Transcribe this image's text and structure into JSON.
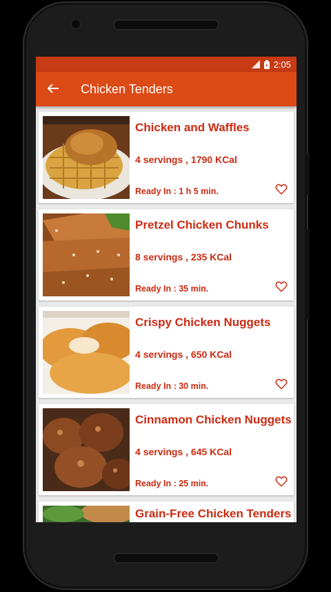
{
  "status_bar": {
    "time": "2:05"
  },
  "app_bar": {
    "title": "Chicken Tenders"
  },
  "recipes": [
    {
      "name": "Chicken and Waffles",
      "servings": "4 servings , 1790 KCal",
      "ready": "Ready In : 1 h 5 min."
    },
    {
      "name": "Pretzel Chicken Chunks",
      "servings": "8 servings , 235 KCal",
      "ready": "Ready In : 35 min."
    },
    {
      "name": "Crispy Chicken Nuggets",
      "servings": "4 servings , 650 KCal",
      "ready": "Ready In : 30 min."
    },
    {
      "name": "Cinnamon Chicken Nuggets",
      "servings": "4 servings , 645 KCal",
      "ready": "Ready In : 25 min."
    },
    {
      "name": "Grain-Free Chicken Tenders",
      "servings": "",
      "ready": ""
    }
  ],
  "colors": {
    "status_bar": "#c63a14",
    "app_bar": "#dc4a16",
    "accent_text": "#cc2a12",
    "card_bg": "#ffffff",
    "list_bg": "#e9e9e9"
  }
}
